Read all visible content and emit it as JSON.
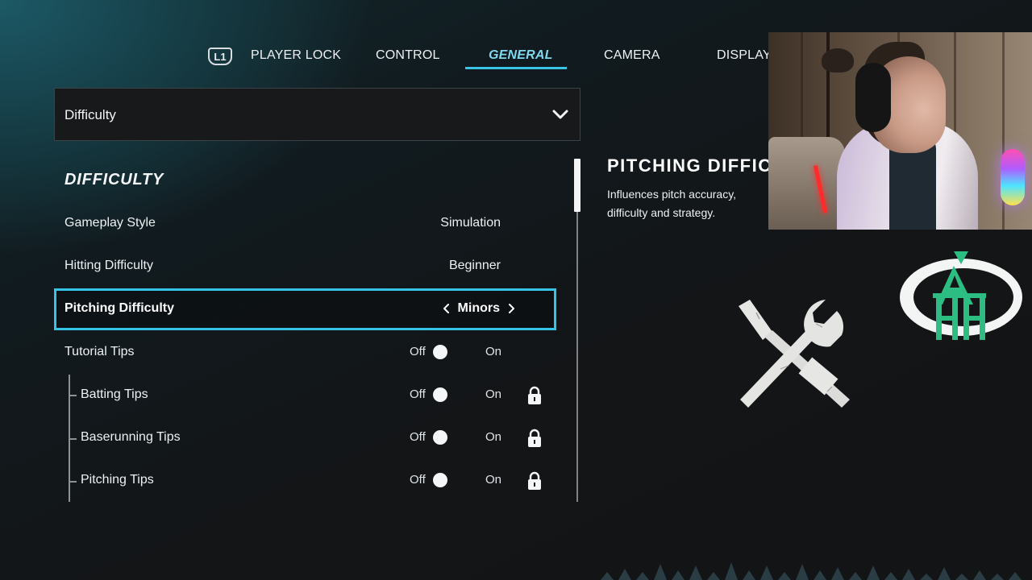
{
  "tabs": {
    "shoulder_button": "L1",
    "items": [
      {
        "label": "PLAYER LOCK",
        "active": false
      },
      {
        "label": "CONTROL",
        "active": false
      },
      {
        "label": "GENERAL",
        "active": true
      },
      {
        "label": "CAMERA",
        "active": false
      },
      {
        "label": "DISPLAY",
        "active": false
      }
    ]
  },
  "dropdown": {
    "label": "Difficulty",
    "icon": "chevron-down-icon"
  },
  "section": {
    "title": "DIFFICULTY"
  },
  "settings": [
    {
      "label": "Gameplay Style",
      "value": "Simulation"
    },
    {
      "label": "Hitting Difficulty",
      "value": "Beginner"
    },
    {
      "label": "Pitching Difficulty",
      "value": "Minors",
      "selected": true
    },
    {
      "label": "Tutorial Tips",
      "off": "Off",
      "on": "On"
    },
    {
      "label": "Batting Tips",
      "off": "Off",
      "on": "On",
      "locked": true
    },
    {
      "label": "Baserunning Tips",
      "off": "Off",
      "on": "On",
      "locked": true
    },
    {
      "label": "Pitching Tips",
      "off": "Off",
      "on": "On",
      "locked": true
    }
  ],
  "detail": {
    "title": "PITCHING DIFFICULTY",
    "description": "Influences pitch accuracy, difficulty and strategy.",
    "icon": "tools-icon"
  },
  "overlay": {
    "logo_letters": "AHH",
    "colors": {
      "accent": "#36c4e6",
      "logo_green": "#2bbd82",
      "background": "#131517"
    }
  }
}
